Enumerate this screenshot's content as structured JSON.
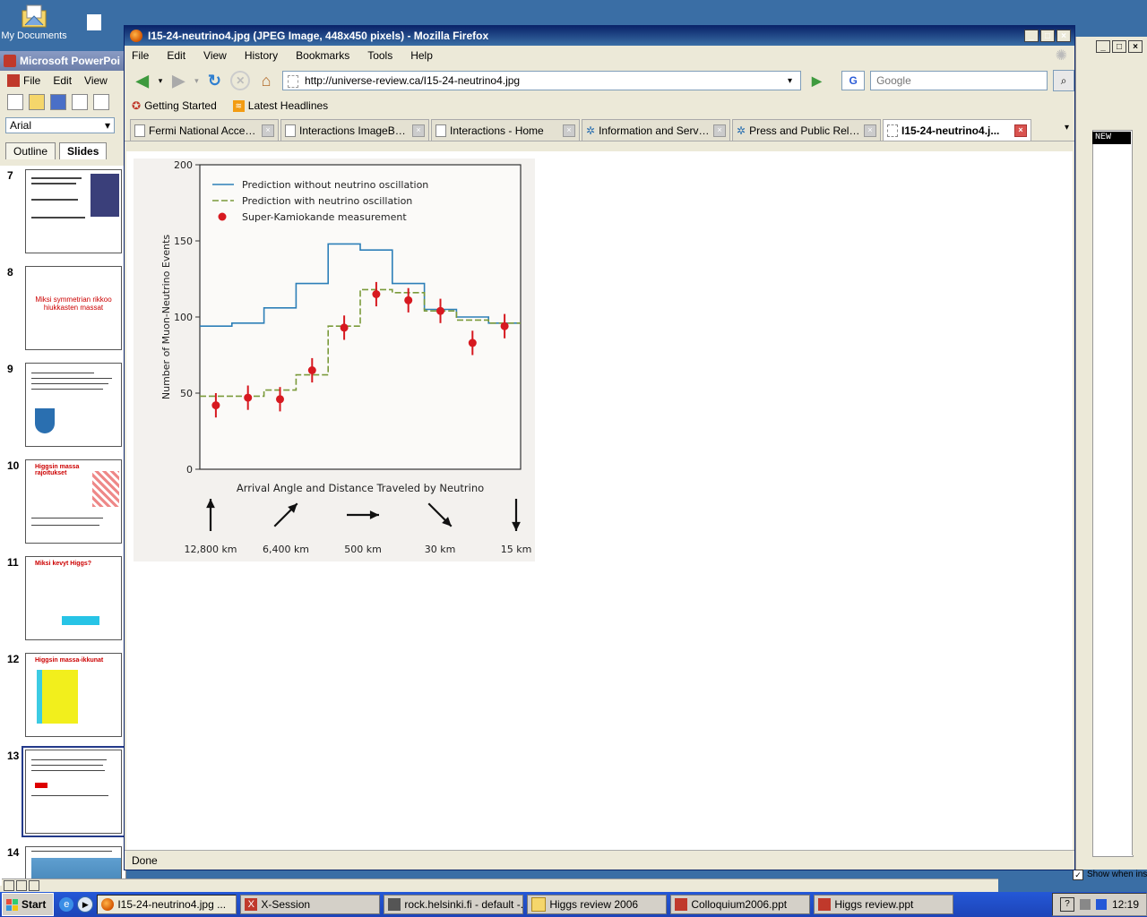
{
  "desktop": {
    "icon_label": "My Documents"
  },
  "powerpoint": {
    "title": "Microsoft PowerPoi",
    "menu": [
      "File",
      "Edit",
      "View"
    ],
    "font": "Arial",
    "tabs": [
      "Outline",
      "Slides"
    ],
    "slides": [
      {
        "num": "7",
        "text": ""
      },
      {
        "num": "8",
        "text": "Miksi symmetrian rikkoo hiukkasten massat"
      },
      {
        "num": "9",
        "text": ""
      },
      {
        "num": "10",
        "text": "Higgsin massa rajoitukset"
      },
      {
        "num": "11",
        "text": "Miksi kevyt Higgs?"
      },
      {
        "num": "12",
        "text": "Higgsin massa-ikkunat"
      },
      {
        "num": "13",
        "text": ""
      },
      {
        "num": "14",
        "text": ""
      }
    ]
  },
  "firefox": {
    "title": "I15-24-neutrino4.jpg (JPEG Image, 448x450 pixels) - Mozilla Firefox",
    "menu": [
      "File",
      "Edit",
      "View",
      "History",
      "Bookmarks",
      "Tools",
      "Help"
    ],
    "url": "http://universe-review.ca/I15-24-neutrino4.jpg",
    "search_placeholder": "Google",
    "bookmarks": [
      "Getting Started",
      "Latest Headlines"
    ],
    "tabs": [
      "Fermi National Acceler...",
      "Interactions ImageBank",
      "Interactions - Home",
      "Information and Servi...",
      "Press and Public Relat...",
      "I15-24-neutrino4.j..."
    ],
    "status": "Done"
  },
  "rightwin": {
    "label": "NEW",
    "checkbox_label": "Show when inse"
  },
  "chart_data": {
    "type": "line",
    "title": "",
    "xlabel": "Arrival Angle and Distance Traveled by Neutrino",
    "ylabel": "Number of Muon-Neutrino Events",
    "ylim": [
      0,
      200
    ],
    "yticks": [
      0,
      50,
      100,
      150,
      200
    ],
    "x_bins": 10,
    "legend_position": "top-left",
    "series": [
      {
        "name": "Prediction without neutrino oscillation",
        "style": "step",
        "color": "#2d7fb8",
        "values": [
          94,
          96,
          106,
          122,
          148,
          144,
          122,
          105,
          100,
          96
        ]
      },
      {
        "name": "Prediction with neutrino oscillation",
        "style": "step-dashed",
        "color": "#7a9a3a",
        "values": [
          48,
          48,
          52,
          62,
          94,
          118,
          116,
          104,
          98,
          96
        ]
      },
      {
        "name": "Super-Kamiokande measurement",
        "style": "points",
        "color": "#d71920",
        "values": [
          42,
          47,
          46,
          65,
          93,
          115,
          111,
          104,
          83,
          94
        ],
        "error": 8
      }
    ],
    "distance_labels": [
      "12,800 km",
      "6,400 km",
      "500 km",
      "30 km",
      "15 km"
    ],
    "arrow_angles_deg": [
      -90,
      -45,
      0,
      45,
      90
    ]
  },
  "taskbar": {
    "start": "Start",
    "tasks": [
      "I15-24-neutrino4.jpg ...",
      "X-Session",
      "rock.helsinki.fi - default -...",
      "Higgs review 2006",
      "Colloquium2006.ppt",
      "Higgs review.ppt"
    ],
    "clock": "12:19"
  }
}
